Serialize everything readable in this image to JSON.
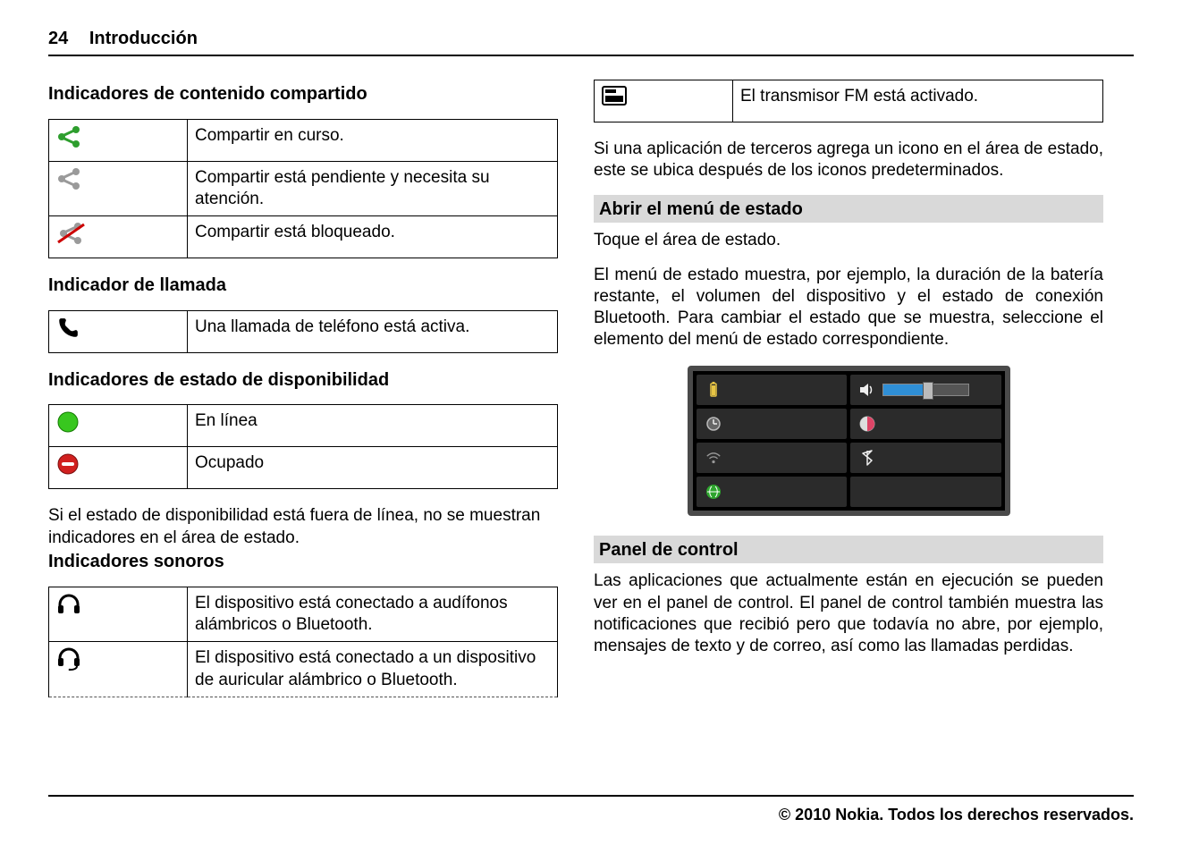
{
  "header": {
    "page_number": "24",
    "chapter": "Introducción"
  },
  "left": {
    "shared_title": "Indicadores de contenido compartido",
    "shared": [
      "Compartir en curso.",
      "Compartir está pendiente y necesita su atención.",
      "Compartir está bloqueado."
    ],
    "call_title": "Indicador de llamada",
    "call": [
      "Una llamada de teléfono está activa."
    ],
    "pres_title": "Indicadores de estado de disponibilidad",
    "pres": [
      "En línea",
      "Ocupado"
    ],
    "pres_note": "Si el estado de disponibilidad está fuera de línea, no se muestran indicadores en el área de estado.",
    "audio_title": "Indicadores sonoros",
    "audio": [
      "El dispositivo está conectado a audífonos alámbricos o Bluetooth.",
      "El dispositivo está conectado a un dispositivo de auricular alámbrico o Bluetooth."
    ]
  },
  "right": {
    "fm_row": "El transmisor FM está activado.",
    "tp_note": "Si una aplicación de terceros agrega un icono en el área de estado, este se ubica después de los iconos predeterminados.",
    "open_status_title": "Abrir el menú de estado",
    "open_status_text": "Toque el área de estado.",
    "status_body": "El menú de estado muestra, por ejemplo, la duración de la batería restante, el volumen del dispositivo y el estado de conexión Bluetooth. Para cambiar el estado que se muestra, seleccione el elemento del menú de estado correspondiente.",
    "panel_title": "Panel de control",
    "panel_body": "Las aplicaciones que actualmente están en ejecución se pueden ver en el panel de control. El panel de control también muestra las notificaciones que recibió pero que todavía no abre, por ejemplo, mensajes de texto y de correo, así como las llamadas perdidas."
  },
  "footer": "© 2010 Nokia. Todos los derechos reservados."
}
